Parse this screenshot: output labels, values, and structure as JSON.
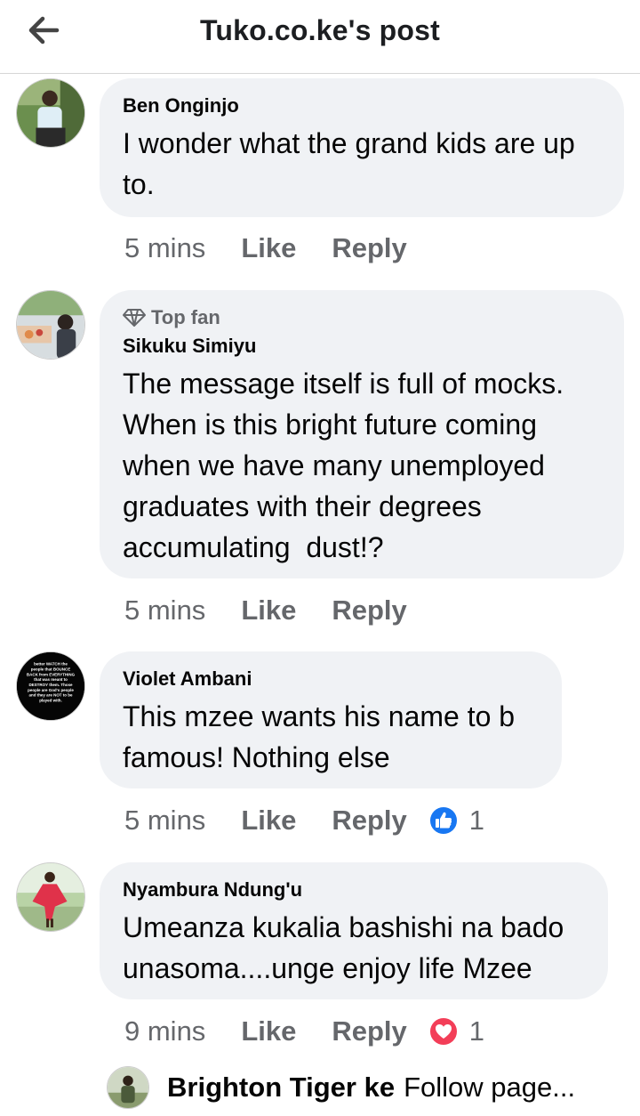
{
  "header": {
    "title": "Tuko.co.ke's post"
  },
  "comments": [
    {
      "author": "Ben Onginjo",
      "badge": "",
      "text_lines": [
        "I wonder what the grand kids are up",
        "to."
      ],
      "time": "5 mins",
      "like": "Like",
      "reply": "Reply",
      "reaction": null,
      "reaction_count": ""
    },
    {
      "author": "Sikuku Simiyu",
      "badge": "Top fan",
      "text_lines": [
        "The message itself is full of mocks.",
        "When is this bright future coming",
        "when we have many unemployed",
        "graduates with their degrees",
        "accumulating  dust!?"
      ],
      "time": "5 mins",
      "like": "Like",
      "reply": "Reply",
      "reaction": null,
      "reaction_count": ""
    },
    {
      "author": "Violet Ambani",
      "badge": "",
      "text_lines": [
        "This mzee wants his name to b",
        "famous! Nothing else"
      ],
      "time": "5 mins",
      "like": "Like",
      "reply": "Reply",
      "reaction": "like-reaction-icon",
      "reaction_count": "1",
      "avatar_text": "better WATCH the people that BOUNCE BACK from EVERYTHING that was meant to DESTROY them. Those people are God's people and they are NOT to be played with."
    },
    {
      "author": "Nyambura Ndung'u",
      "badge": "",
      "text_lines": [
        "Umeanza kukalia bashishi na bado",
        "unasoma....unge enjoy life Mzee"
      ],
      "time": "9 mins",
      "like": "Like",
      "reply": "Reply",
      "reaction": "love-reaction-icon",
      "reaction_count": "1"
    }
  ],
  "footer": {
    "name": "Brighton Tiger ke",
    "action": "Follow page..."
  },
  "colors": {
    "bubble": "#f0f2f5",
    "secondary_text": "#65676b",
    "like_blue": "#1877f2",
    "love_red": "#f33e58"
  }
}
